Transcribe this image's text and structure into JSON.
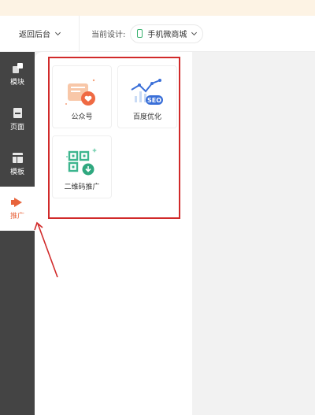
{
  "toolbar": {
    "back_label": "返回后台",
    "design_label": "当前设计:",
    "design_value": "手机微商城"
  },
  "sidebar": {
    "items": [
      {
        "label": "模块",
        "icon": "module-icon"
      },
      {
        "label": "页面",
        "icon": "page-icon"
      },
      {
        "label": "模板",
        "icon": "template-icon"
      },
      {
        "label": "推广",
        "icon": "megaphone-icon",
        "active": true
      }
    ]
  },
  "panel": {
    "cards": [
      {
        "label": "公众号",
        "icon": "wechat-official-account-icon"
      },
      {
        "label": "百度优化",
        "icon": "seo-icon",
        "badge": "SEO"
      },
      {
        "label": "二维码推广",
        "icon": "qrcode-download-icon"
      }
    ]
  },
  "colors": {
    "sidebar_bg": "#444444",
    "accent": "#e8643c",
    "highlight": "#d12a2a",
    "banner": "#fdf3e4"
  }
}
